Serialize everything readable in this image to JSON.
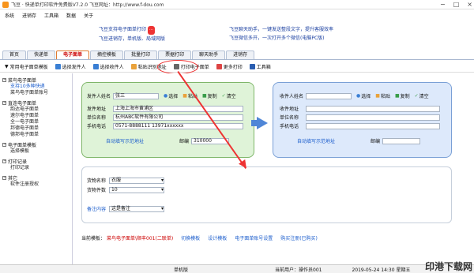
{
  "window": {
    "title": "飞豆 · 快递单打印软件免费版V7.2.0   飞豆网址：http://www.f-dou.com",
    "controls": [
      "−",
      "□",
      "×"
    ]
  },
  "menu": [
    "系统",
    "进销存",
    "工具箱",
    "数据",
    "关于"
  ],
  "banner": {
    "left": [
      "飞豆支持电子面单打印",
      "飞豆进销存，单机版、局域网版"
    ],
    "badge": "···",
    "right": [
      "飞豆聊天助手，一键发送整段文字，提升客服效率",
      "飞豆微信多开，一次打开多个微信(电脑PC版)"
    ]
  },
  "tabs": [
    "首页",
    "快递单",
    "电子面单",
    "摘控模板",
    "批量打印",
    "票据打印",
    "聊天助手",
    "进销存"
  ],
  "active_tab": "电子面单",
  "toolbar": [
    "常用电子面单模板",
    "选择发件人",
    "选择收件人",
    "粘贴识别地址",
    "打印电子面单",
    "更多打印",
    "工具箱"
  ],
  "sidebar": [
    {
      "title": "菜鸟电子面单",
      "items": [
        "支持10多种快递",
        "菜鸟电子面单账号"
      ]
    },
    {
      "title": "直连电子面单",
      "items": [
        "韵达电子面单",
        "速尔电子面单",
        "全一电子面单",
        "邦德电子面单",
        "德邦电子面单"
      ]
    },
    {
      "title": "电子面单模板",
      "items": [
        "选择模板"
      ]
    },
    {
      "title": "打印记录",
      "items": [
        "打印记录"
      ]
    },
    {
      "title": "其它",
      "items": [
        "软件注册授权"
      ]
    }
  ],
  "sender": {
    "name_label": "发件人姓名",
    "name": "张三",
    "addr_label": "发件地址",
    "addr": "上海上海市黄浦区",
    "company_label": "单位名称",
    "company": "杭州ABC软件有限公司",
    "phone_label": "手机电话",
    "phone": "0571-8888111  13971xxxxxx",
    "auto_link": "自动填写示范地址",
    "zip_label": "邮编",
    "zip": "310000",
    "actions": [
      "选择",
      "粘贴",
      "复制",
      "清空"
    ]
  },
  "receiver": {
    "name_label": "收件人姓名",
    "addr_label": "收件地址",
    "company_label": "单位名称",
    "phone_label": "手机电话",
    "auto_link": "自动填写示范地址",
    "zip_label": "邮编",
    "actions": [
      "选择",
      "粘贴",
      "复制",
      "清空"
    ]
  },
  "goods": {
    "name_label": "货物名称",
    "name": "衣服",
    "count_label": "货物件数",
    "count": "10",
    "remark_label": "备注内容",
    "remark": "这是备注"
  },
  "bottom": {
    "template_label": "当前模板：",
    "template": "菜鸟电子面单\\顺丰001(二联单)",
    "links": [
      "切换模板",
      "设计模板",
      "电子面单账号设置",
      "购买注册(已购买)"
    ]
  },
  "status": {
    "left": "单机版",
    "user": "当前用户：操作员001",
    "time": "2019-05-24 14:30 星期五"
  },
  "watermark": "印港下载网"
}
